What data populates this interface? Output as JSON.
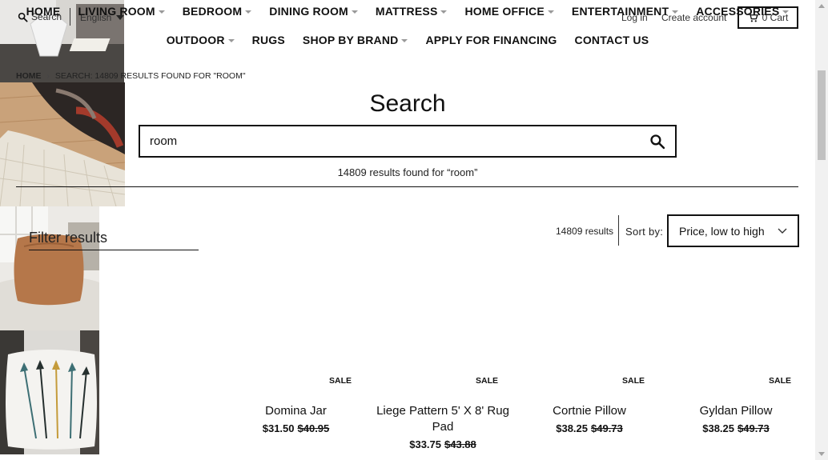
{
  "topbar": {
    "search_label": "Search",
    "language": "English",
    "login": "Log in",
    "create_account": "Create account",
    "cart": "0 Cart"
  },
  "nav": {
    "row1": [
      {
        "label": "HOME",
        "dropdown": false
      },
      {
        "label": "LIVING ROOM",
        "dropdown": true
      },
      {
        "label": "BEDROOM",
        "dropdown": true
      },
      {
        "label": "DINING ROOM",
        "dropdown": true
      },
      {
        "label": "MATTRESS",
        "dropdown": true
      },
      {
        "label": "HOME OFFICE",
        "dropdown": true
      },
      {
        "label": "ENTERTAINMENT",
        "dropdown": true
      },
      {
        "label": "ACCESSORIES",
        "dropdown": true
      }
    ],
    "row2": [
      {
        "label": "OUTDOOR",
        "dropdown": true
      },
      {
        "label": "RUGS",
        "dropdown": false
      },
      {
        "label": "SHOP BY BRAND",
        "dropdown": true
      },
      {
        "label": "APPLY FOR FINANCING",
        "dropdown": false
      },
      {
        "label": "CONTACT US",
        "dropdown": false
      }
    ]
  },
  "breadcrumb": {
    "home": "HOME",
    "separator": "›",
    "current": "SEARCH: 14809 RESULTS FOUND FOR \"ROOM\""
  },
  "page_title": "Search",
  "search": {
    "value": "room",
    "results_text": "14809 results found for “room”"
  },
  "filter": {
    "title": "Filter results"
  },
  "toolbar": {
    "count": "14809 results",
    "sort_label": "Sort by:",
    "sort_value": "Price, low to high"
  },
  "products": [
    {
      "name": "Domina Jar",
      "price": "$31.50",
      "compare_price": "$40.95",
      "badge": "SALE"
    },
    {
      "name": "Liege Pattern 5' X 8' Rug Pad",
      "price": "$33.75",
      "compare_price": "$43.88",
      "badge": "SALE"
    },
    {
      "name": "Cortnie Pillow",
      "price": "$38.25",
      "compare_price": "$49.73",
      "badge": "SALE"
    },
    {
      "name": "Gyldan Pillow",
      "price": "$38.25",
      "compare_price": "$49.73",
      "badge": "SALE"
    }
  ],
  "colors": {
    "text": "#111111",
    "border": "#111111",
    "background": "#ffffff"
  }
}
